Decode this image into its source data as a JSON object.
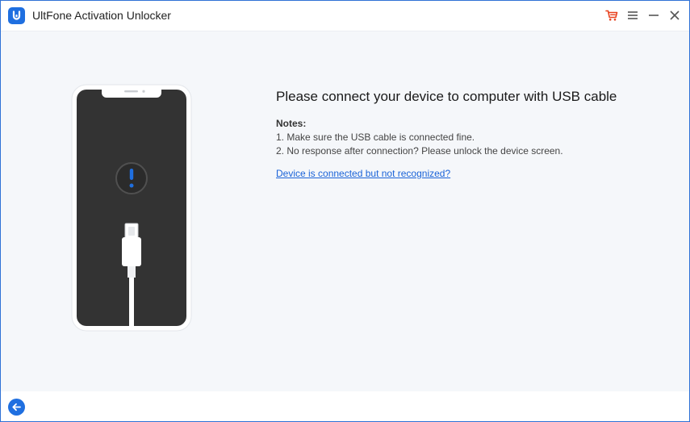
{
  "app": {
    "title": "UltFone Activation Unlocker",
    "logo_icon": "ultfone-logo-icon",
    "accent_color": "#1a63d8"
  },
  "titlebar": {
    "buttons": [
      {
        "icon": "cart-icon",
        "color": "#e8401c"
      },
      {
        "icon": "menu-icon",
        "color": "#555555"
      },
      {
        "icon": "minimize-icon",
        "color": "#555555"
      },
      {
        "icon": "close-icon",
        "color": "#555555"
      }
    ]
  },
  "main": {
    "heading": "Please connect your device to computer with USB cable",
    "notes_title": "Notes:",
    "notes": [
      "1. Make sure the USB cable is connected fine.",
      "2. No response after connection? Please unlock the device screen."
    ],
    "help_link": "Device is connected but not recognized?",
    "illustration": {
      "device_icon": "phone-icon",
      "alert_icon": "exclamation-icon",
      "cable_icon": "usb-cable-icon",
      "alert_color": "#1f6fe0"
    }
  },
  "footer": {
    "back_icon": "back-arrow-icon"
  }
}
